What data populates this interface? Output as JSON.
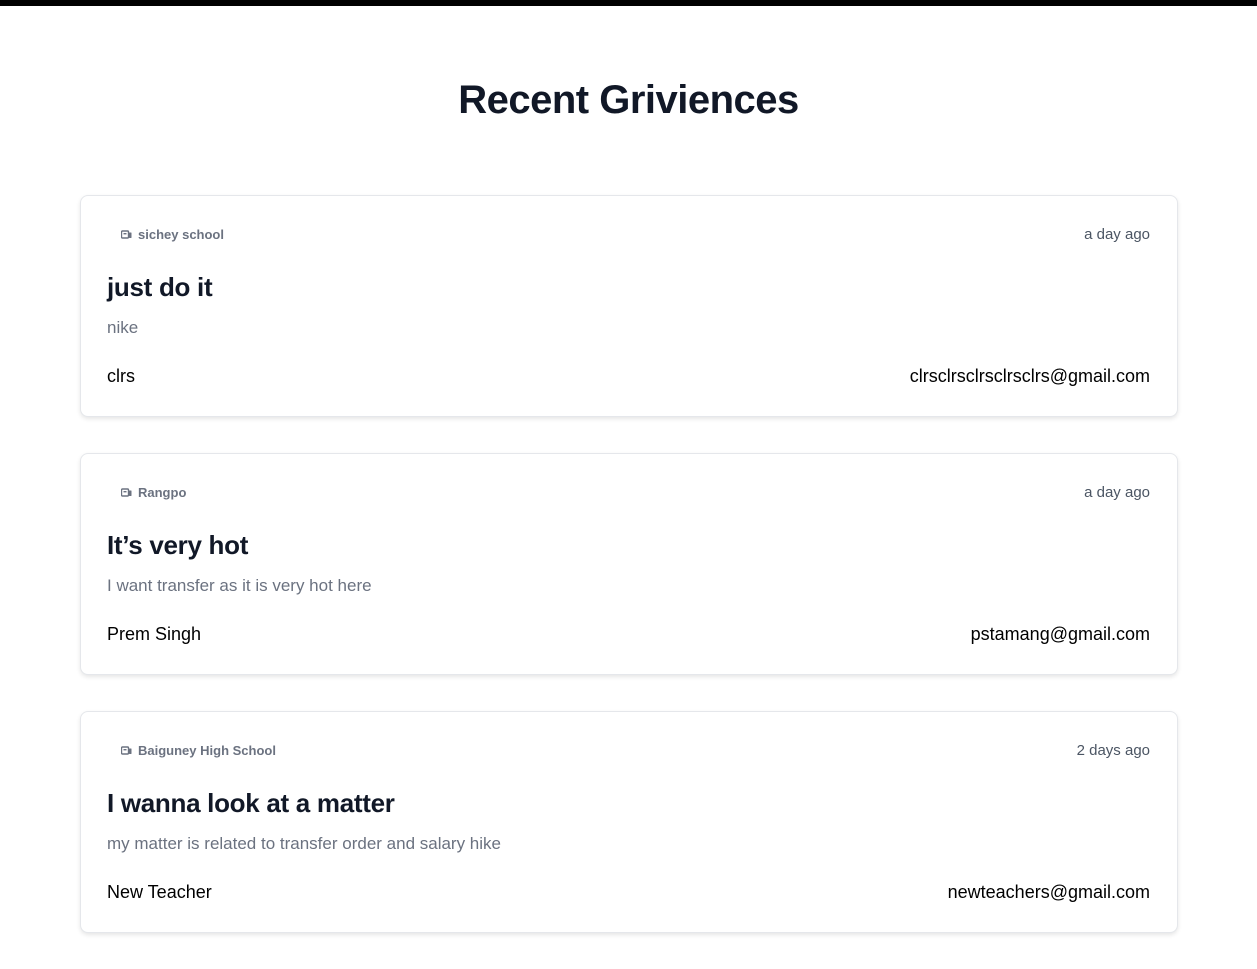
{
  "page": {
    "title": "Recent Griviences"
  },
  "grievances": [
    {
      "school": "sichey school",
      "time": "a day ago",
      "title": "just do it",
      "description": "nike",
      "name": "clrs",
      "email": "clrsclrsclrsclrsclrs@gmail.com"
    },
    {
      "school": "Rangpo",
      "time": "a day ago",
      "title": "It’s very hot",
      "description": "I want transfer as it is very hot here",
      "name": "Prem Singh",
      "email": "pstamang@gmail.com"
    },
    {
      "school": "Baiguney High School",
      "time": "2 days ago",
      "title": "I wanna look at a matter",
      "description": "my matter is related to transfer order and salary hike",
      "name": "New Teacher",
      "email": "newteachers@gmail.com"
    }
  ],
  "icons": {
    "school": "school-building-icon"
  },
  "colors": {
    "title": "#111827",
    "muted": "#6b7280",
    "border": "#e5e7eb",
    "top_bar": "#000000"
  }
}
